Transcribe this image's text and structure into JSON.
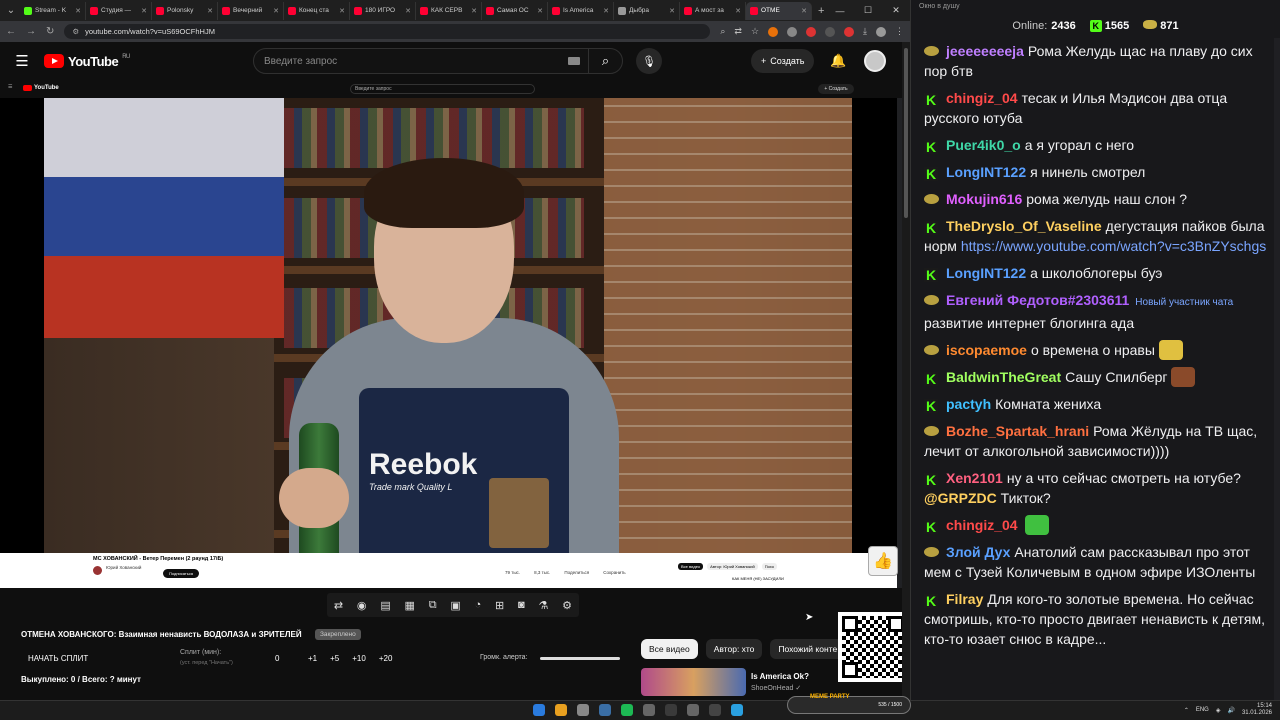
{
  "browser": {
    "tabs": [
      {
        "label": "Stream - K",
        "color": "#53fc18"
      },
      {
        "label": "Студия —",
        "color": "#ff0033"
      },
      {
        "label": "Polonsky",
        "color": "#ff0033"
      },
      {
        "label": "Вечерний",
        "color": "#ff0033"
      },
      {
        "label": "Конец ста",
        "color": "#ff0033"
      },
      {
        "label": "180 ИГРО",
        "color": "#ff0033"
      },
      {
        "label": "КАК СЕРВ",
        "color": "#ff0033"
      },
      {
        "label": "Самая ОС",
        "color": "#ff0033"
      },
      {
        "label": "Is America",
        "color": "#ff0033"
      },
      {
        "label": "Дыбра",
        "color": "#999999"
      },
      {
        "label": "А мост за",
        "color": "#ff0033"
      },
      {
        "label": "ОТМЕ",
        "color": "#ff0033"
      }
    ],
    "url": "youtube.com/watch?v=uS69OCFhHJM"
  },
  "youtube": {
    "logo_text": "YouTube",
    "logo_region": "RU",
    "search_placeholder": "Введите запрос",
    "create_label": "Создать"
  },
  "nested": {
    "logo_text": "YouTube",
    "search_placeholder": "Введите запрос",
    "create_label": "+ Создать",
    "video_title": "МС ХОВАНСКИЙ - Ветер Перемен (2 раунд 17іБ)",
    "channel": "Юрий Хованский",
    "subscribe": "Подписаться",
    "actions": [
      "79 тыс.",
      "8,3 тыс.",
      "Поделиться",
      "Сохранить"
    ],
    "chips": [
      "Все видео",
      "Автор: Юрий Хованский",
      "Похо"
    ],
    "rec_title": "КАК МЕНЯ (НЕ) ЗАСУДИЛИ"
  },
  "video": {
    "brand_text": "Reebok",
    "brand_sub": "Trade mark Quality L"
  },
  "panel": {
    "title": "ОТМЕНА ХОВАНСКОГО: Взаимная ненависть ВОДОЛАЗА и ЗРИТЕЛЕЙ",
    "badge": "Закреплено",
    "split_start": "НАЧАТЬ СПЛИТ",
    "split_label": "Сплит (мин):",
    "split_sub": "(уст. перед \"Начать\")",
    "split_value": "0",
    "split_steps": [
      "+1",
      "+5",
      "+10",
      "+20"
    ],
    "alert_label": "Громк. алерта:",
    "bought": "Выкуплено: 0 / Всего: ? минут",
    "chips": [
      "Все видео",
      "Автор: хто",
      "Похожий конте"
    ],
    "rec_title": "Is America Ok?",
    "rec_channel": "ShoeOnHead ✓"
  },
  "chat": {
    "window_title": "Окно в душу",
    "online_label": "Online:",
    "online": "2436",
    "kick_count": "1565",
    "sub_count": "871",
    "messages": [
      {
        "badge": "sub",
        "user": "jeeeeeeeeja",
        "color": "#bf7fff",
        "text": "Рома Желудь щас на плаву до сих пор бтв"
      },
      {
        "badge": "kick",
        "user": "chingiz_04",
        "color": "#ff4a4a",
        "text": "тесак и Илья Мэдисон два отца русского ютуба"
      },
      {
        "badge": "kick",
        "user": "Puer4ik0_o",
        "color": "#3fd8a8",
        "text": "а я угорал с него"
      },
      {
        "badge": "kick",
        "user": "LongINT122",
        "color": "#5aa0ff",
        "text": "я нинель смотрел"
      },
      {
        "badge": "sub",
        "user": "Mokujin616",
        "color": "#e060ff",
        "text": "рома желудь наш слон ?"
      },
      {
        "badge": "kick",
        "user": "TheDryslo_Of_Vaseline",
        "color": "#ffd060",
        "text": "дегустация пайков была норм",
        "link": "https://www.youtube.com/watch?v=c3BnZYschgs"
      },
      {
        "badge": "kick",
        "user": "LongINT122",
        "color": "#5aa0ff",
        "text": "а школоблогеры буэ"
      },
      {
        "badge": "sub",
        "user": "Евгений Федотов#2303611",
        "color": "#b060ff",
        "tag": "Новый участник чата",
        "text": "развитие интернет блогинга ада"
      },
      {
        "badge": "sub",
        "user": "iscopaemoe",
        "color": "#ff8a30",
        "text": "о времена о нравы",
        "emote": "#e0c040"
      },
      {
        "badge": "kick",
        "user": "BaldwinTheGreat",
        "color": "#a0ff60",
        "text": "Сашу Спилберг",
        "emote": "#8a4a2a"
      },
      {
        "badge": "kick",
        "user": "pactyh",
        "color": "#40c0ff",
        "text": "Комната жениха"
      },
      {
        "badge": "sub",
        "user": "Bozhe_Spartak_hrani",
        "color": "#ff7040",
        "text": "Рома Жёлудь на ТВ щас, лечит от алкогольной зависимости))))"
      },
      {
        "badge": "kick",
        "user": "Xen2101",
        "color": "#ff6080",
        "text": "ну а что сейчас смотреть на ютубе?",
        "mention": "@GRPZDC",
        "after": " Тикток?"
      },
      {
        "badge": "kick",
        "user": "chingiz_04",
        "color": "#ff4a4a",
        "text": "",
        "emote": "#40c040"
      },
      {
        "badge": "sub",
        "user": "Злой Дух",
        "color": "#5aa0ff",
        "text": "Анатолий сам рассказывал про этот мем с Тузей Количевым в одном эфире ИЗОленты"
      },
      {
        "badge": "kick",
        "user": "Filray",
        "color": "#ffd060",
        "text": "Для кого-то золотые времена. Но сейчас смотришь, кто-то просто двигает ненависть к детям, кто-то юзает снюс в кадре..."
      }
    ]
  },
  "taskbar": {
    "meme_party": "MEME PARTY",
    "meme_count": "535 / 1500",
    "lang": "ENG",
    "time": "15:14",
    "date": "31.01.2026"
  }
}
